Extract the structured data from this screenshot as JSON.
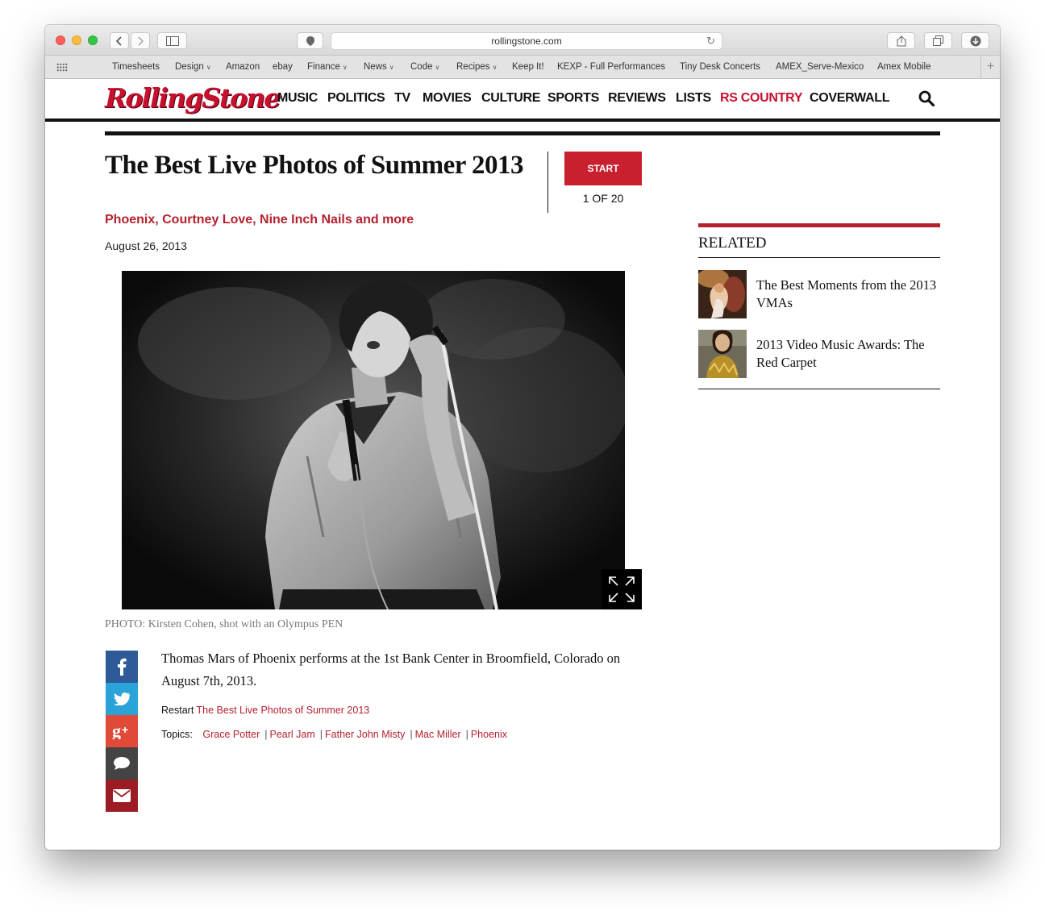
{
  "browser": {
    "url": "rollingstone.com",
    "bookmarks": [
      {
        "label": "Timesheets",
        "menu": false
      },
      {
        "label": "Design",
        "menu": true
      },
      {
        "label": "Amazon",
        "menu": false
      },
      {
        "label": "ebay",
        "menu": false
      },
      {
        "label": "Finance",
        "menu": true
      },
      {
        "label": "News",
        "menu": true
      },
      {
        "label": "Code",
        "menu": true
      },
      {
        "label": "Recipes",
        "menu": true
      },
      {
        "label": "Keep It!",
        "menu": false
      },
      {
        "label": "KEXP - Full Performances",
        "menu": false
      },
      {
        "label": "Tiny Desk Concerts",
        "menu": false
      },
      {
        "label": "AMEX_Serve-Mexico",
        "menu": false
      },
      {
        "label": "Amex Mobile",
        "menu": false
      }
    ]
  },
  "site": {
    "logo": "RollingStone",
    "nav": [
      "MUSIC",
      "POLITICS",
      "TV",
      "MOVIES",
      "CULTURE",
      "SPORTS",
      "REVIEWS",
      "LISTS",
      "RS COUNTRY",
      "COVERWALL"
    ],
    "accent": "#c8102e"
  },
  "article": {
    "title": "The Best Live Photos of Summer 2013",
    "start_label": "START",
    "counter": "1 OF 20",
    "subtitle": "Phoenix, Courtney Love, Nine Inch Nails and more",
    "date": "August 26, 2013",
    "photo_credit": "PHOTO: Kirsten Cohen, shot with an Olympus PEN",
    "caption": "Thomas Mars of Phoenix performs at the 1st Bank Center in Broomfield, Colorado on August 7th, 2013.",
    "restart_label": "Restart",
    "restart_link": "The Best Live Photos of Summer 2013",
    "topics_label": "Topics:",
    "topics": [
      "Grace Potter",
      "Pearl Jam",
      "Father John Misty",
      "Mac Miller",
      "Phoenix"
    ]
  },
  "share_icons": [
    "facebook-icon",
    "twitter-icon",
    "google-plus-icon",
    "comment-icon",
    "email-icon"
  ],
  "related": {
    "heading": "RELATED",
    "items": [
      {
        "title": "The Best Moments from the 2013 VMAs"
      },
      {
        "title": "2013 Video Music Awards: The Red Carpet"
      }
    ]
  }
}
